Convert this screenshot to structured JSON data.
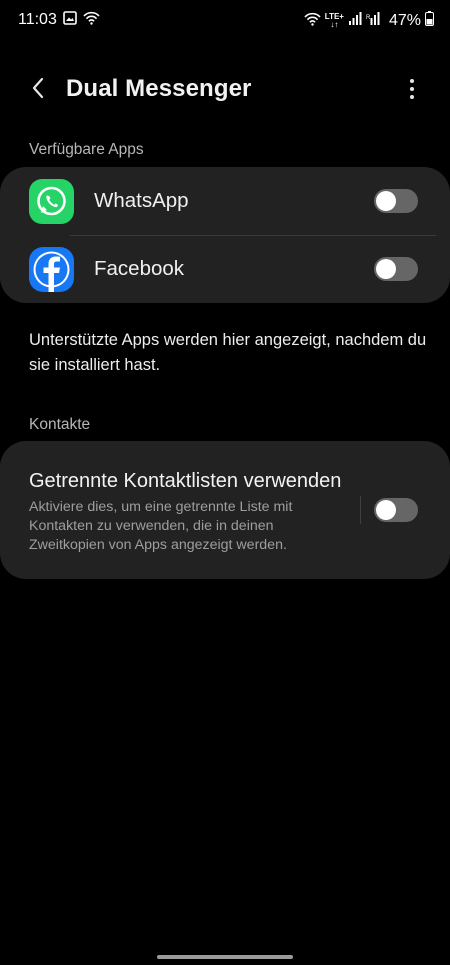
{
  "status_bar": {
    "time": "11:03",
    "network": "LTE+",
    "battery": "47%",
    "icons": [
      "gallery-icon",
      "wifi-icon",
      "wifi-icon",
      "signal-icon",
      "signal-icon",
      "battery-icon"
    ]
  },
  "header": {
    "title": "Dual Messenger",
    "back_icon": "back-arrow-icon",
    "menu_icon": "more-options-icon"
  },
  "sections": {
    "available_apps": "Verfügbare Apps",
    "contacts": "Kontakte"
  },
  "apps": [
    {
      "label": "WhatsApp",
      "icon": "whatsapp-icon",
      "enabled": false,
      "color": "#25D366"
    },
    {
      "label": "Facebook",
      "icon": "facebook-icon",
      "enabled": false,
      "color": "#1877F2"
    }
  ],
  "note": "Unterstützte Apps werden hier angezeigt, nachdem du sie installiert hast.",
  "contacts_setting": {
    "title": "Getrennte Kontaktlisten verwenden",
    "description": "Aktiviere dies, um eine getrennte Liste mit Kontakten zu verwenden, die in deinen Zweitkopien von Apps angezeigt werden.",
    "enabled": false
  },
  "colors": {
    "background": "#000000",
    "card": "#222222",
    "toggle_off": "#666666"
  }
}
